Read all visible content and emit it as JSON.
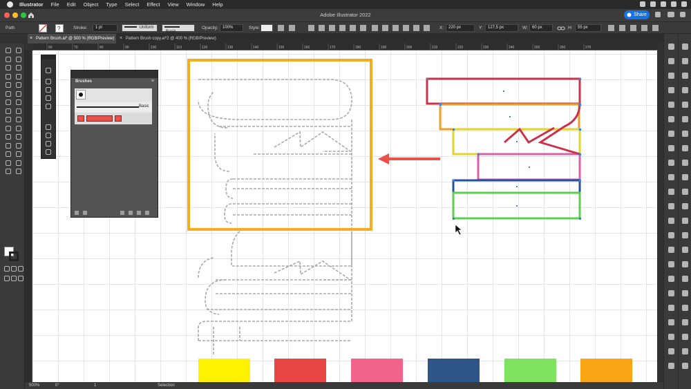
{
  "menubar": {
    "app_name": "Illustrator",
    "items": [
      "File",
      "Edit",
      "Object",
      "Type",
      "Select",
      "Effect",
      "View",
      "Window",
      "Help"
    ]
  },
  "window": {
    "title": "Adobe Illustrator 2022",
    "share_label": "Share"
  },
  "control_bar": {
    "selection_label": "Path",
    "stroke_label": "Stroke:",
    "stroke_weight": "1 pt",
    "profile_label": "Uniform",
    "brush_label": "Basic",
    "opacity_label": "Opacity:",
    "opacity_value": "100%",
    "style_label": "Style:",
    "x_label": "X:",
    "x_value": "220 px",
    "y_label": "Y:",
    "y_value": "127,5 px",
    "w_label": "W:",
    "w_value": "60 px",
    "h_label": "H:",
    "h_value": "55 px"
  },
  "tabs": [
    {
      "label": "Pattern Brush.ai* @ 500 % (RGB/Preview)",
      "active": true
    },
    {
      "label": "Pattern Brush copy.ai*2 @ 400 % (RGB/Preview)",
      "active": false
    }
  ],
  "ruler": {
    "ticks": [
      "60",
      "70",
      "80",
      "90",
      "100",
      "110",
      "120",
      "130",
      "140",
      "150",
      "160",
      "170",
      "180",
      "190",
      "200",
      "210",
      "220",
      "230",
      "240",
      "250",
      "260",
      "270"
    ]
  },
  "brushes_panel": {
    "tab_label": "Brushes",
    "basic_label": "Basic"
  },
  "status_bar": {
    "zoom": "500%",
    "rotation": "0°",
    "artboard": "1",
    "mode": "Selection"
  },
  "colors": {
    "highlight_box": "#f5ad1b",
    "arrow": "#e8524a",
    "swatches": [
      "#fff200",
      "#e84545",
      "#f0648c",
      "#2e5587",
      "#7fe35f",
      "#f9a516"
    ],
    "stripe_colors": [
      "#c8324a",
      "#e8a12a",
      "#e3d42a",
      "#d85fa8",
      "#284f9c",
      "#5dcc52"
    ]
  },
  "icons": {
    "apple": "apple-icon",
    "home": "home-icon",
    "share": "share-icon",
    "search": "search-icon",
    "cursor": "mouse-cursor-icon"
  }
}
